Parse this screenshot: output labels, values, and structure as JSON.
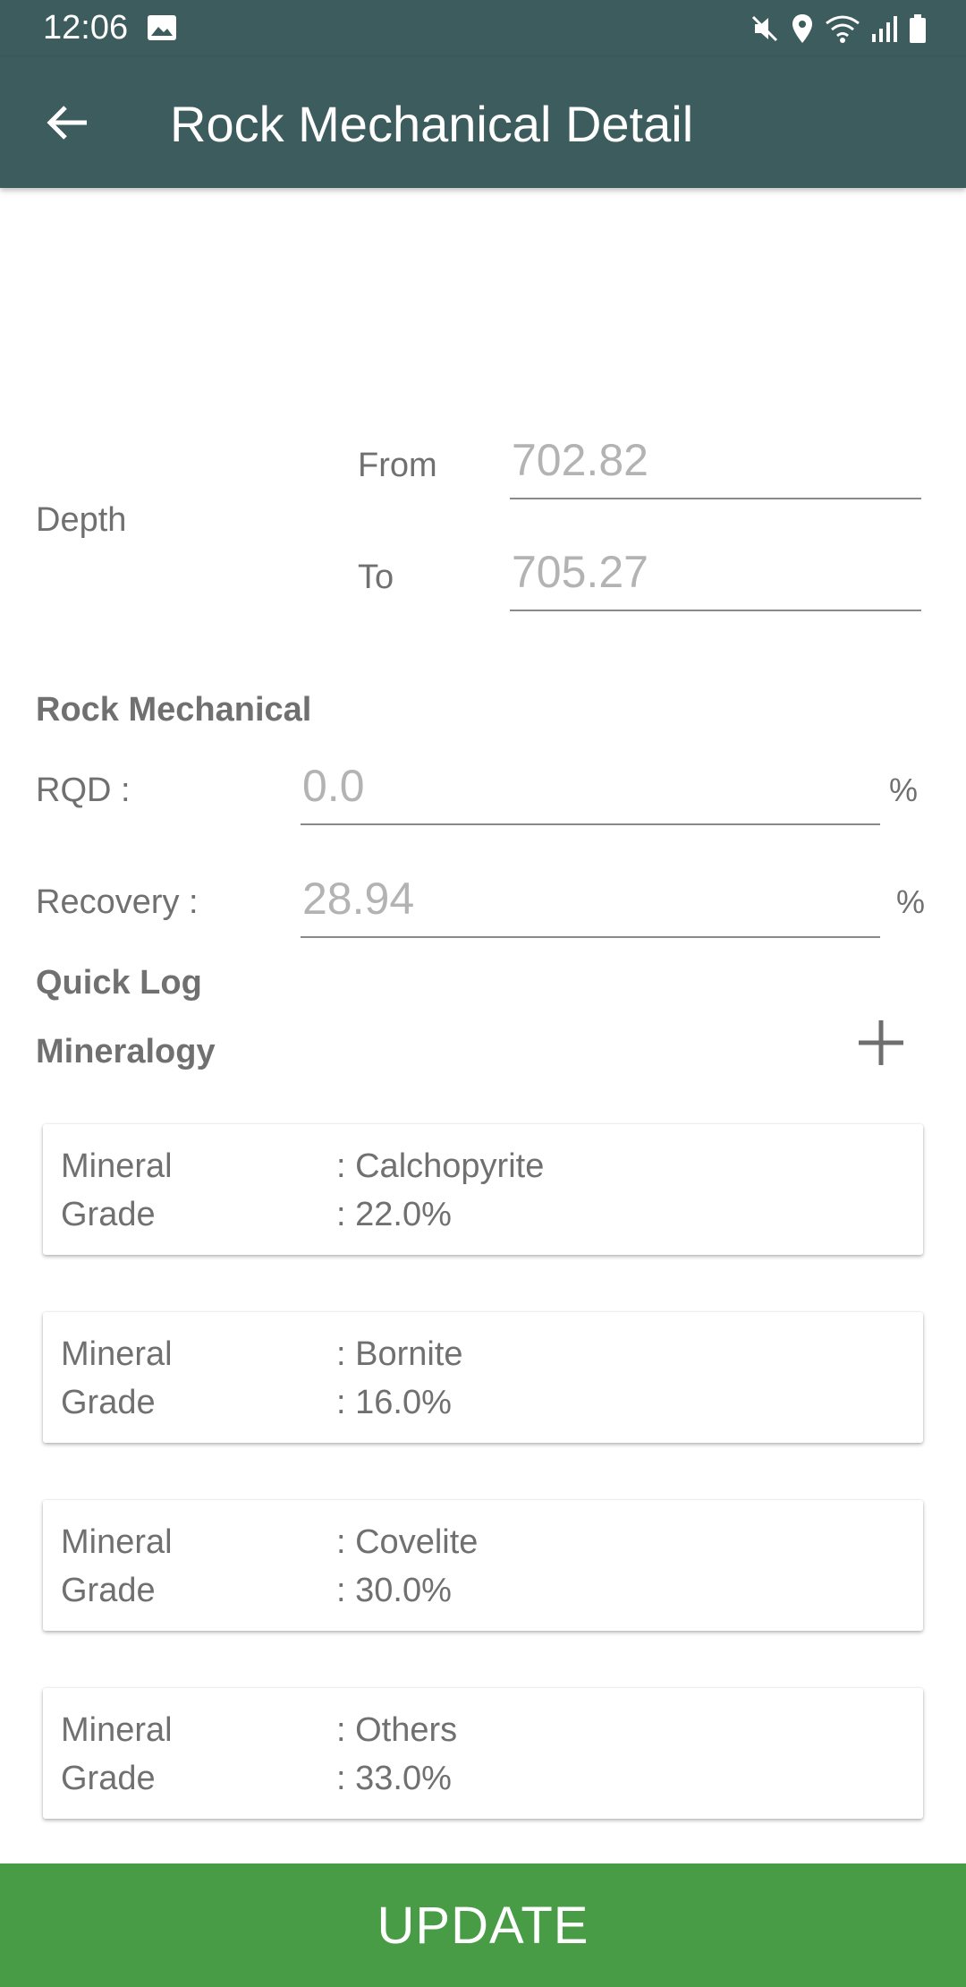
{
  "status_bar": {
    "time": "12:06",
    "icons": [
      "image-icon",
      "mute-icon",
      "location-icon",
      "wifi-icon",
      "signal-icon",
      "battery-icon"
    ]
  },
  "app_bar": {
    "title": "Rock Mechanical Detail",
    "back_icon": "arrow-back-icon",
    "background": "#3d5c5d"
  },
  "depth": {
    "label": "Depth",
    "from_label": "From",
    "from_value": "702.82",
    "to_label": "To",
    "to_value": "705.27"
  },
  "rock_mechanical": {
    "title": "Rock Mechanical",
    "rqd_label": "RQD :",
    "rqd_value": "0.0",
    "rqd_unit": "%",
    "recovery_label": "Recovery :",
    "recovery_value": "28.94",
    "recovery_unit": "%"
  },
  "quick_log": {
    "title": "Quick Log",
    "mineralogy_title": "Mineralogy",
    "add_icon": "plus-icon"
  },
  "minerals": [
    {
      "mineral_label": "Mineral",
      "mineral_value": ": Calchopyrite",
      "grade_label": "Grade",
      "grade_value": ": 22.0%"
    },
    {
      "mineral_label": "Mineral",
      "mineral_value": ": Bornite",
      "grade_label": "Grade",
      "grade_value": ": 16.0%"
    },
    {
      "mineral_label": "Mineral",
      "mineral_value": ": Covelite",
      "grade_label": "Grade",
      "grade_value": ": 30.0%"
    },
    {
      "mineral_label": "Mineral",
      "mineral_value": ": Others",
      "grade_label": "Grade",
      "grade_value": ": 33.0%"
    }
  ],
  "footer": {
    "update_label": "UPDATE",
    "button_color": "#479c45"
  }
}
